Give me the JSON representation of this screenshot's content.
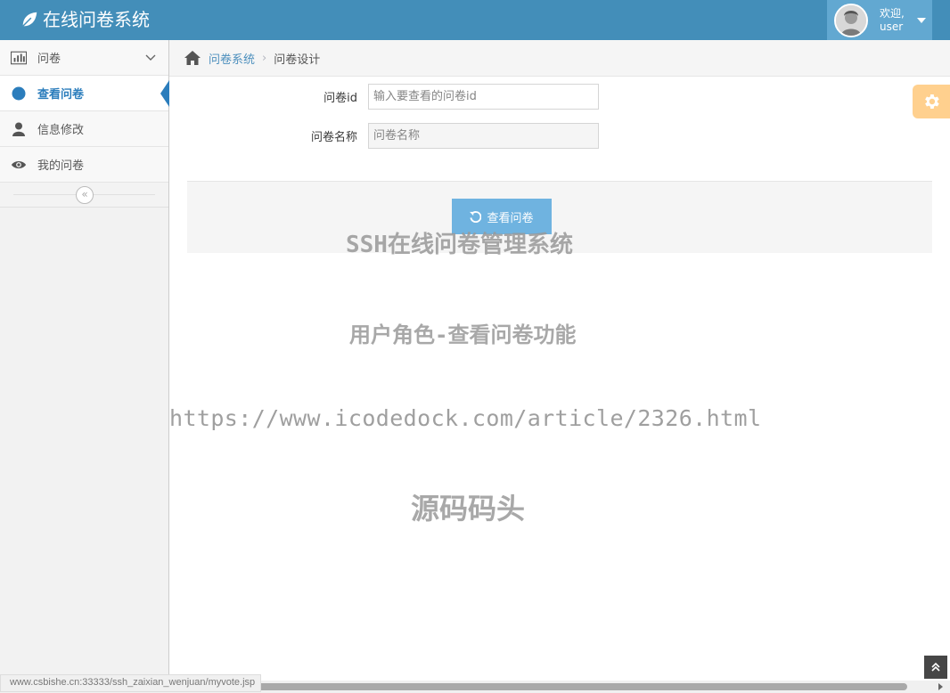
{
  "navbar": {
    "brand": "在线问卷系统",
    "welcome": "欢迎,",
    "username": "user"
  },
  "sidebar": {
    "items": [
      {
        "label": "问卷",
        "icon": "bar-chart-icon"
      },
      {
        "label": "查看问卷",
        "icon": "circle-icon",
        "active": true
      },
      {
        "label": "信息修改",
        "icon": "user-icon"
      },
      {
        "label": "我的问卷",
        "icon": "eye-icon"
      }
    ],
    "collapse_glyph": "«"
  },
  "breadcrumb": {
    "link": "问卷系统",
    "separator": "›",
    "current": "问卷设计"
  },
  "form": {
    "id_label": "问卷id",
    "id_placeholder": "输入要查看的问卷id",
    "name_label": "问卷名称",
    "name_placeholder": "问卷名称"
  },
  "actions": {
    "view_label": "查看问卷"
  },
  "watermark": {
    "line1": "SSH在线问卷管理系统",
    "line2": "用户角色-查看问卷功能",
    "line3": "https://www.icodedock.com/article/2326.html",
    "line4": "源码码头"
  },
  "status_bar": {
    "url": "www.csbishe.cn:33333/ssh_zaixian_wenjuan/myvote.jsp"
  },
  "colors": {
    "navbar": "#438eb9",
    "user_box": "#62a8d1",
    "accent": "#2b7dbc",
    "button": "#6fb3e0",
    "settings": "#ffb752"
  }
}
